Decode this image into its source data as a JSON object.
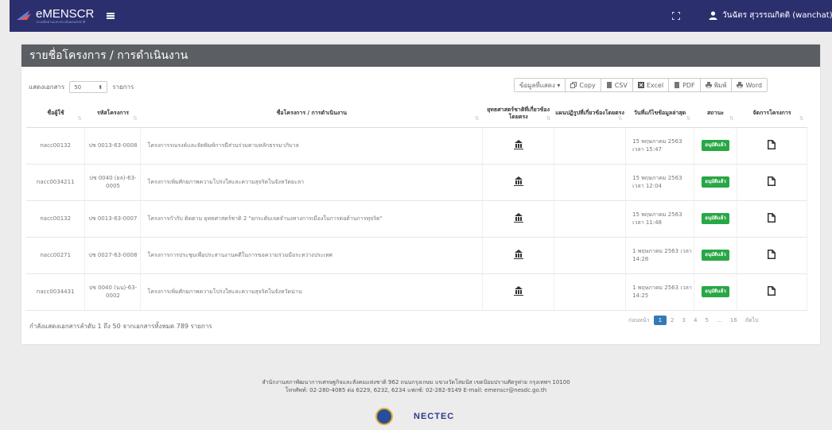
{
  "app": {
    "title": "eMENSCR",
    "subtitle": "ระบบติดตามและประเมินผลแห่งชาติ"
  },
  "user": {
    "name": "วันฉัตร สุวรรณกิตติ (wanchat)"
  },
  "page_title": "รายชื่อโครงการ / การดำเนินงาน",
  "controls": {
    "show_prefix": "แสดงเอกสาร",
    "page_size": "50",
    "show_suffix": "รายการ",
    "buttons": [
      "ข้อมูลที่แสดง ▾",
      "Copy",
      "CSV",
      "Excel",
      "PDF",
      "พิมพ์",
      "Word"
    ]
  },
  "table": {
    "headers": [
      "ชื่อผู้ใช้",
      "รหัสโครงการ",
      "ชื่อโครงการ / การดำเนินงาน",
      "ยุทธศาสตร์ชาติที่เกี่ยวข้องโดยตรง",
      "แผนปฏิรูปที่เกี่ยวข้องโดยตรง",
      "วันที่แก้ไขข้อมูลล่าสุด",
      "สถานะ",
      "จัดการโครงการ"
    ],
    "rows": [
      {
        "user": "nacc00132",
        "code": "ปช 0013-63-0008",
        "name": "โครงการรณรงค์และจัดพิมพ์การมีส่วนร่วมตามหลักธรรมาภิบาล",
        "date": "15 พฤษภาคม 2563 เวลา 15:47",
        "status": "อนุมัติแล้ว"
      },
      {
        "user": "nacc0034211",
        "code": "ปช 0040 (ยล)-63-0005",
        "name": "โครงการเพิ่มศักยภาพความโปร่งใสและความสุจริตในจังหวัดยะลา",
        "date": "15 พฤษภาคม 2563 เวลา 12:04",
        "status": "อนุมัติแล้ว"
      },
      {
        "user": "nacc00132",
        "code": "ปช 0013-63-0007",
        "name": "โครงการกำกับ ติดตาม ยุทธศาสตร์ชาติ 2 \"ยกระดับเจตจำนงทางการเมืองในการต่อต้านการทุจริต\"",
        "date": "15 พฤษภาคม 2563 เวลา 11:48",
        "status": "อนุมัติแล้ว"
      },
      {
        "user": "nacc00271",
        "code": "ปช 0027-63-0008",
        "name": "โครงการการประชุมเพื่อประสานงานคดีในการขอความร่วมมือระหว่างประเทศ",
        "date": "1 พฤษภาคม 2563 เวลา 14:28",
        "status": "อนุมัติแล้ว"
      },
      {
        "user": "nacc0034431",
        "code": "ปช 0040 (นน)-63-0002",
        "name": "โครงการเพิ่มศักยภาพความโปร่งใสและความสุจริตในจังหวัดน่าน",
        "date": "1 พฤษภาคม 2563 เวลา 14:25",
        "status": "อนุมัติแล้ว"
      }
    ]
  },
  "info": "กำลังแสดงเอกสารลำดับ 1 ถึง 50 จากเอกสารทั้งหมด 789 รายการ",
  "pagination": {
    "prev": "ก่อนหน้า",
    "pages": [
      "1",
      "2",
      "3",
      "4",
      "5",
      "…",
      "16"
    ],
    "next": "ถัดไป"
  },
  "footer": {
    "line1": "สำนักงานสภาพัฒนาการเศรษฐกิจและสังคมแห่งชาติ 962 ถนนกรุงเกษม แขวงวัดโสมนัส เขตป้อมปราบศัตรูพ่าย กรุงเทพฯ 10100",
    "line2": "โทรศัพท์: 02-280-4085 ต่อ 6229, 6232, 6234 แฟกซ์: 02-282-9149 E-mail: emenscr@nesdc.go.th",
    "partner": "NECTEC"
  },
  "colors": {
    "topbar": "#2c2f6e",
    "header": "#5b5e62",
    "status_green": "#28a745",
    "page_active": "#337ab7"
  }
}
